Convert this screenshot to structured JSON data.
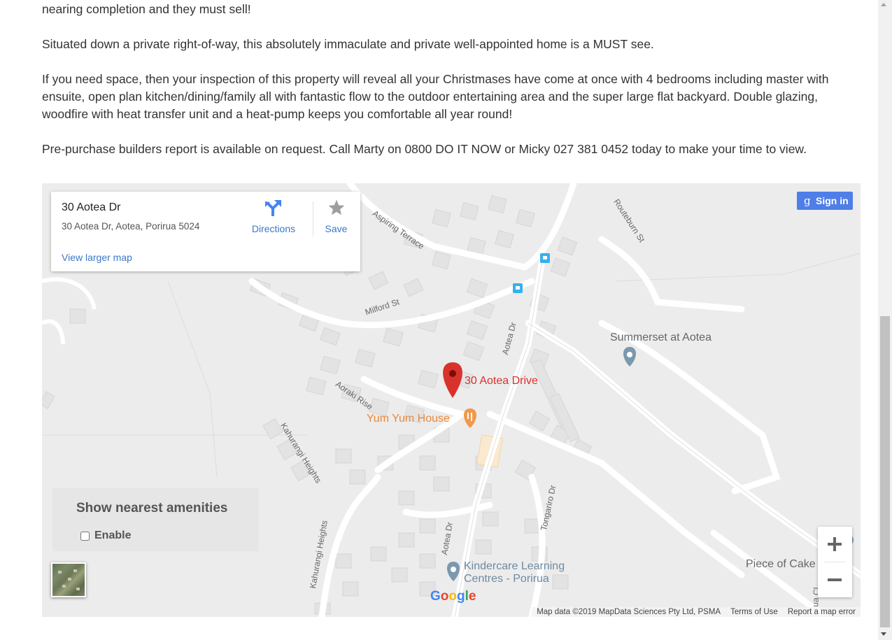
{
  "description": {
    "p1": "nearing completion and they must sell!",
    "p2": "Situated down a private right-of-way, this absolutely immaculate and private well-appointed home is a MUST see.",
    "p3": "If you need space, then your inspection of this property will reveal all your Christmases have come at once with 4 bedrooms including master with ensuite, open plan kitchen/dining/family all with fantastic flow to the outdoor entertaining area and the super large flat backyard. Double glazing, woodfire with heat transfer unit and a heat-pump keeps you comfortable all year round!",
    "p4": "Pre-purchase builders report is available on request. Call Marty on 0800 DO IT NOW or Micky 027 381 0452 today to make your time to view."
  },
  "map": {
    "info_card": {
      "title": "30 Aotea Dr",
      "address": "30 Aotea Dr, Aotea, Porirua 5024",
      "directions_label": "Directions",
      "save_label": "Save",
      "view_larger_label": "View larger map"
    },
    "sign_in_label": "Sign in",
    "amenities": {
      "title": "Show nearest amenities",
      "checkbox_label": "Enable",
      "checked": false
    },
    "zoom_in_icon": "plus-icon",
    "zoom_out_icon": "minus-icon",
    "logo": "Google",
    "attribution": {
      "map_data": "Map data ©2019 MapData Sciences Pty Ltd, PSMA",
      "terms": "Terms of Use",
      "report": "Report a map error"
    },
    "labels": {
      "marker": "30 Aotea Drive",
      "restaurant": "Yum Yum House",
      "summerset": "Summerset at Aotea",
      "kindercare_1": "Kindercare Learning",
      "kindercare_2": "Centres - Porirua",
      "piece_of_cake": "Piece of Cake",
      "aspiring": "Aspiring Terrace",
      "routeburn": "Routeburn St",
      "milford": "Milford St",
      "aotea_dr_top": "Aotea Dr",
      "aotea_dr_bottom": "Aotea Dr",
      "aoraki": "Aoraki Rise",
      "kahurangi_1": "Kahurangi Heights",
      "kahurangi_2": "Kahurangi Heights",
      "tongariro": "Tongariro Dr",
      "clipped_cl": "ua Cl"
    },
    "colors": {
      "marker": "#d9322c",
      "restaurant": "#e8883a",
      "poi": "#7b98ad",
      "link": "#3a79c8",
      "signin": "#4f7ee8"
    }
  }
}
